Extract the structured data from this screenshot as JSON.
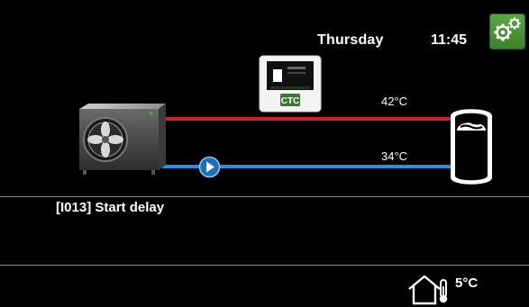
{
  "header": {
    "day": "Thursday",
    "time": "11:45",
    "settings_icon": "gears-icon",
    "settings_color": "#4f9a3a"
  },
  "system": {
    "supply_temp": "42°C",
    "return_temp": "34°C",
    "controller_logo": "CTC",
    "hot_pipe_color": "#d01f25",
    "cold_pipe_color": "#2a8dde"
  },
  "info": {
    "message": "[I013] Start delay"
  },
  "footer": {
    "outdoor_temp": "5°C",
    "outdoor_icon": "house-thermometer-icon"
  }
}
